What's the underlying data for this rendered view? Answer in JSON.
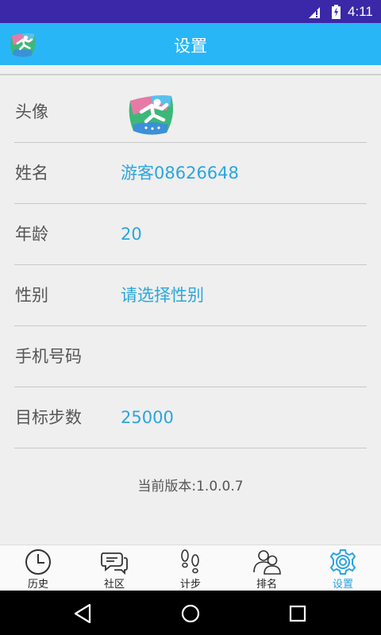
{
  "status": {
    "time": "4:11"
  },
  "header": {
    "title": "设置"
  },
  "profile": {
    "rows": [
      {
        "label": "头像",
        "value": ""
      },
      {
        "label": "姓名",
        "value": "游客08626648"
      },
      {
        "label": "年龄",
        "value": "20"
      },
      {
        "label": "性别",
        "value": "请选择性别"
      },
      {
        "label": "手机号码",
        "value": ""
      },
      {
        "label": "目标步数",
        "value": "25000"
      }
    ]
  },
  "version": "当前版本:1.0.0.7",
  "tabs": [
    {
      "label": "历史",
      "icon": "clock-icon"
    },
    {
      "label": "社区",
      "icon": "chat-icon"
    },
    {
      "label": "计步",
      "icon": "footprints-icon"
    },
    {
      "label": "排名",
      "icon": "users-icon"
    },
    {
      "label": "设置",
      "icon": "gear-icon",
      "active": true
    }
  ],
  "colors": {
    "accent": "#29b6f6",
    "status_bar": "#3a28a8",
    "value_text": "#2aa6de",
    "active_tab": "#29a3e3"
  }
}
